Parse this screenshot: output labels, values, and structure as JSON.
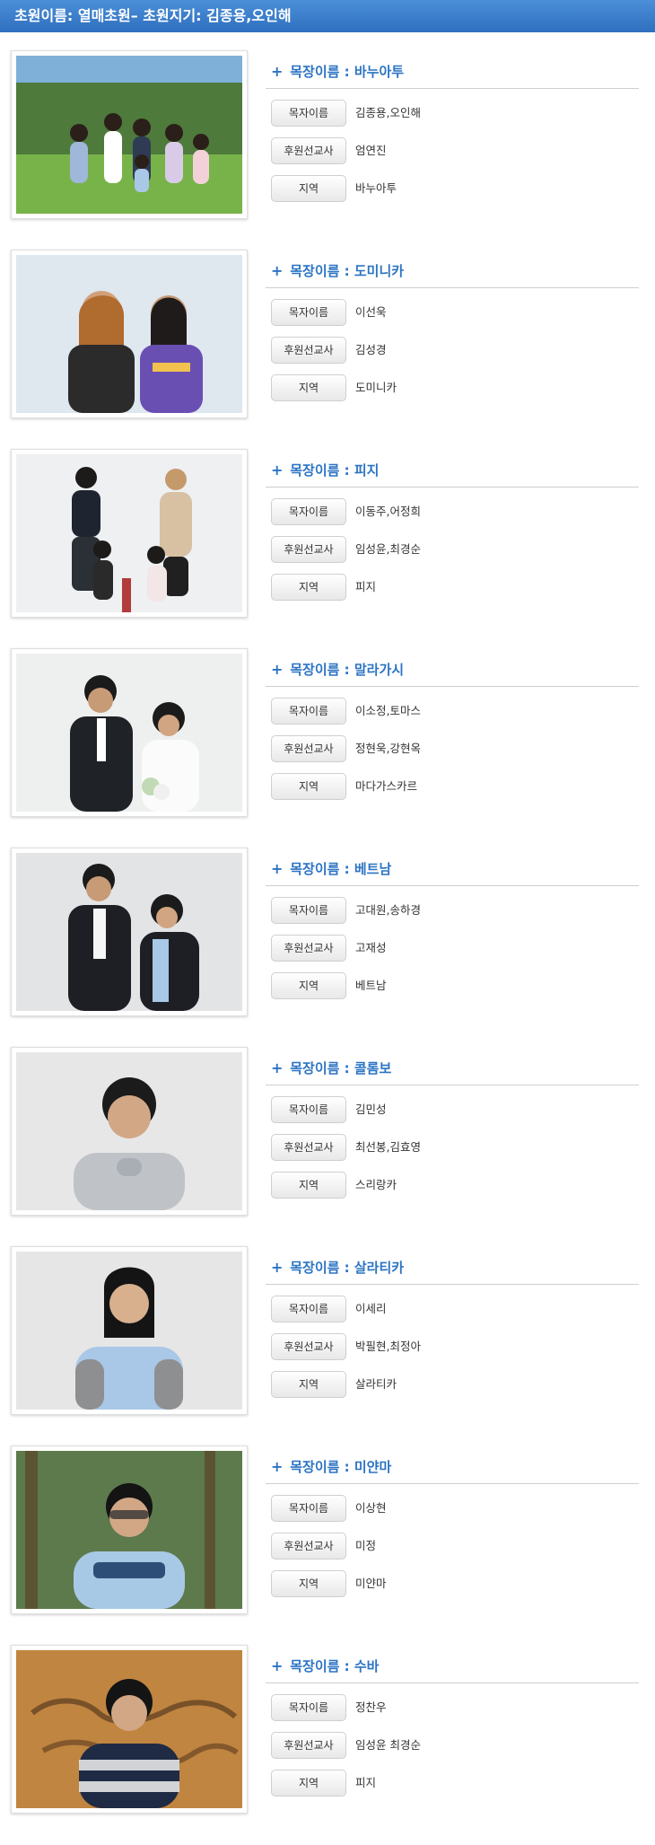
{
  "header": {
    "title": "초원이름: 열매초원– 초원지기: 김종용,오인해"
  },
  "labels": {
    "pastor": "목자이름",
    "missionary": "후원선교사",
    "region": "지역"
  },
  "groups": [
    {
      "title": "목장이름 : 바누아투",
      "pastor": "김종용,오인해",
      "missionary": "엄연진",
      "region": "바누아투",
      "photo": "family photo outdoors on grass",
      "colors": {
        "bg": "#6f9a4d",
        "accent": "#c9d6e6"
      }
    },
    {
      "title": "목장이름 : 도미니카",
      "pastor": "이선욱",
      "missionary": "김성경",
      "region": "도미니카",
      "photo": "two people indoors",
      "colors": {
        "bg": "#dfe7ef",
        "accent": "#6a4fb3"
      }
    },
    {
      "title": "목장이름 : 피지",
      "pastor": "이동주,어정희",
      "missionary": "임성윤,최경순",
      "region": "피지",
      "photo": "family portrait studio",
      "colors": {
        "bg": "#eef0f2",
        "accent": "#c9b49a"
      }
    },
    {
      "title": "목장이름 : 말라가시",
      "pastor": "이소정,토마스",
      "missionary": "정현욱,강현옥",
      "region": "마다가스카르",
      "photo": "couple portrait studio",
      "colors": {
        "bg": "#e9eaeb",
        "accent": "#1f2227"
      }
    },
    {
      "title": "목장이름 : 베트남",
      "pastor": "고대원,송하경",
      "missionary": "고재성",
      "region": "베트남",
      "photo": "couple portrait indoors",
      "colors": {
        "bg": "#e3e4e6",
        "accent": "#1d1f24"
      }
    },
    {
      "title": "목장이름 : 콜롬보",
      "pastor": "김민성",
      "missionary": "최선봉,김효영",
      "region": "스리랑카",
      "photo": "portrait of young man",
      "colors": {
        "bg": "#e7e7e7",
        "accent": "#bfc3c8"
      }
    },
    {
      "title": "목장이름 : 살라티카",
      "pastor": "이세리",
      "missionary": "박필현,최정아",
      "region": "살라티카",
      "photo": "portrait of young woman",
      "colors": {
        "bg": "#e6e6e6",
        "accent": "#a9c7e6"
      }
    },
    {
      "title": "목장이름 : 미얀마",
      "pastor": "이상현",
      "missionary": "미정",
      "region": "미얀마",
      "photo": "portrait outdoors with trees",
      "colors": {
        "bg": "#2f5c2f",
        "accent": "#a8c9e6"
      }
    },
    {
      "title": "목장이름 : 수바",
      "pastor": "정찬우",
      "missionary": "임성윤 최경순",
      "region": "피지",
      "photo": "portrait in front of world map",
      "colors": {
        "bg": "#a86a2a",
        "accent": "#1f2a44"
      }
    }
  ]
}
